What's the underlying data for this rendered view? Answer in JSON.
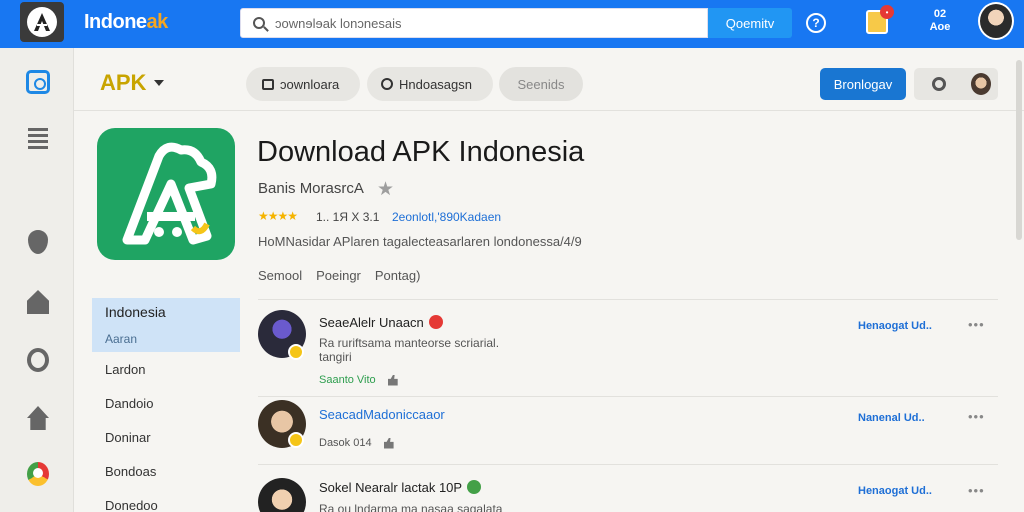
{
  "topbar": {
    "brand_main": "Indone",
    "brand_tail": "ak",
    "search_value": "ɔownɘlɘak Ɩonɔnesais",
    "search_button": "Qoemitv",
    "user_line1": "02",
    "user_line2": "Aoe",
    "colors": {
      "bar": "#1877f2",
      "search_button": "#2196f3"
    }
  },
  "secondary": {
    "apk_label": "APK",
    "pill_download": "ɔownloara",
    "pill_user": "Hndoasagsn",
    "pill_search": "Seenids",
    "primary_button": "Bronlogav"
  },
  "app": {
    "title": "Download APK Indonesia",
    "developer": "Banis  MorasrcA",
    "rating_stars": "★★★★",
    "rating_meta": "1.. 1Я X 3.1",
    "rating_link": "2eonlotl,'890Kadaen",
    "description": "HoMNasidar APlaren tagalecteasarlaren londonessa/4/9",
    "meta": [
      "Semool",
      "Poeingr",
      "Pontag)"
    ],
    "icon_color": "#1fa463"
  },
  "languages": {
    "active": "Indonesia",
    "sub": "Aaran",
    "items": [
      "Lardon",
      "Dandoio",
      "Doninar",
      "Bondoas",
      "Donedoo"
    ]
  },
  "reviews": [
    {
      "name": "SeaeAlelr Unaacn",
      "text_line1": "Ra ruriftsama manteorse scriarial.",
      "text_line2": "tangiri",
      "foot": "Saanto Vito",
      "action": "Henaogat Ud..",
      "more": "•••"
    },
    {
      "name": "SeacadMadoniccaaor",
      "foot": "Dasok 014",
      "action": "Nanenal  Ud..",
      "more": "•••"
    },
    {
      "name": "Sokel  Nearalr lactak  10P",
      "text_line1": "Ra ou lndarma ma nasaa sagalata",
      "action": "Henaogat Ud..",
      "more": "•••"
    }
  ]
}
